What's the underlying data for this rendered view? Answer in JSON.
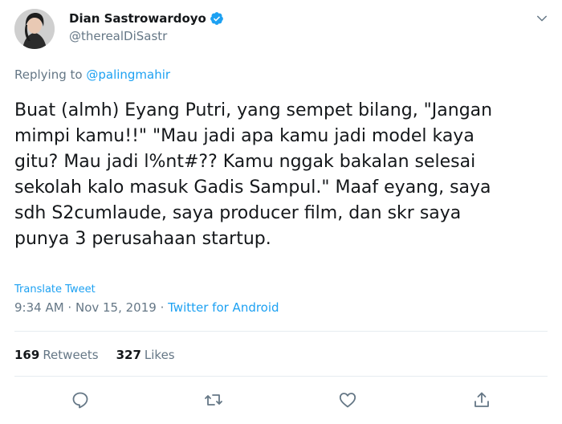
{
  "user": {
    "display_name": "Dian Sastrowardoyo",
    "handle": "@therealDiSastr"
  },
  "reply": {
    "prefix": "Replying to",
    "mention": "@palingmahir"
  },
  "tweet": {
    "lines": [
      "Buat (almh) Eyang Putri, yang sempet bilang, \"Jangan",
      "mimpi kamu!!\" \"Mau jadi apa kamu jadi model kaya",
      "gitu? Mau jadi l%nt#?? Kamu nggak bakalan selesai",
      "sekolah kalo masuk Gadis Sampul.\" Maaf eyang, saya",
      "sdh S2cumlaude, saya producer film, dan skr saya",
      "punya 3 perusahaan startup."
    ],
    "translate_label": "Translate Tweet",
    "time": "9:34 AM",
    "date": "Nov 15, 2019",
    "source": "Twitter for Android",
    "separator": " · "
  },
  "stats": {
    "retweets_count": "169",
    "retweets_label": "Retweets",
    "likes_count": "327",
    "likes_label": "Likes"
  },
  "actions": [
    {
      "icon": "reply-icon"
    },
    {
      "icon": "retweet-icon"
    },
    {
      "icon": "like-icon"
    },
    {
      "icon": "share-icon"
    }
  ],
  "colors": {
    "accent": "#1da1f2",
    "text": "#14171a",
    "secondary": "#657786",
    "divider": "#e6ecf0"
  }
}
